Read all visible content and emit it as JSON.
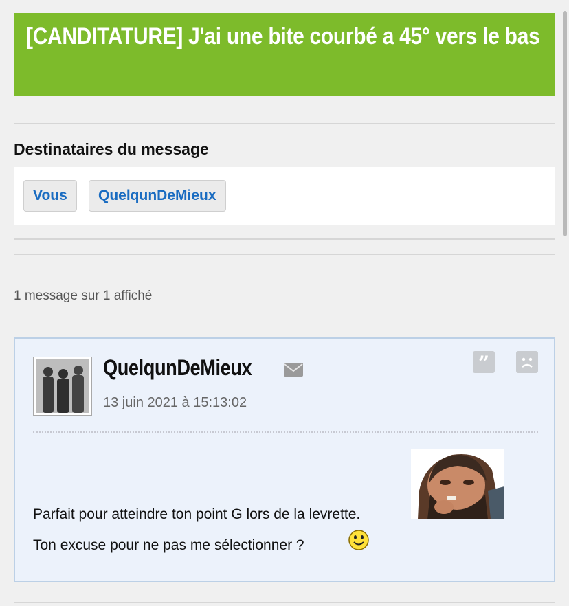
{
  "topic": {
    "title": "[CANDITATURE] J'ai une bite courbé a 45° vers le bas"
  },
  "recipients": {
    "heading": "Destinataires du message",
    "items": [
      {
        "label": "Vous"
      },
      {
        "label": "QuelqunDeMieux"
      }
    ]
  },
  "messages_count": "1 message sur 1 affiché",
  "message": {
    "author": "QuelqunDeMieux",
    "date": "13 juin 2021 à 15:13:02",
    "line1": "Parfait pour atteindre ton point G lors de la levrette.",
    "line2": "Ton excuse pour ne pas me sélectionner ?",
    "icons": [
      "mail-icon",
      "quote-icon",
      "report-icon",
      "smiley-icon"
    ]
  },
  "colors": {
    "title_bg": "#7dbb2b",
    "link": "#1a6cc1",
    "message_bg": "#ecf2fb",
    "message_border": "#bcd0e6"
  }
}
